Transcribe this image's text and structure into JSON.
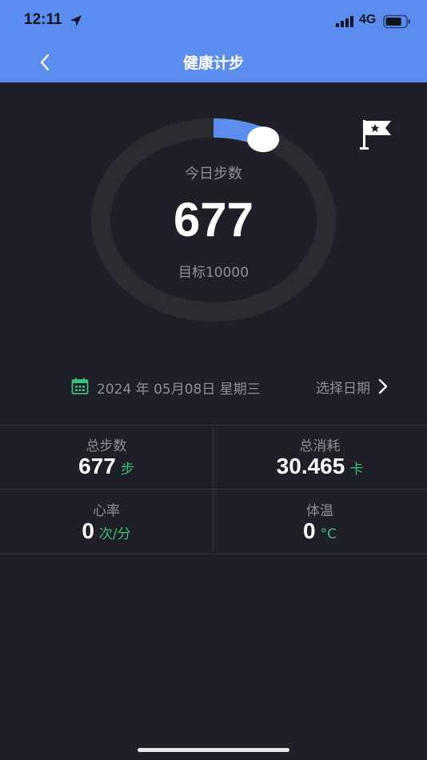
{
  "status_bar": {
    "time": "12:11",
    "network": "4G",
    "battery_level": 0.8,
    "icons": [
      "location-arrow-icon",
      "signal-icon",
      "battery-icon"
    ]
  },
  "nav": {
    "title": "健康计步",
    "back_icon": "chevron-left-icon"
  },
  "ring": {
    "label": "今日步数",
    "steps": 677,
    "steps_text": "677",
    "goal": 10000,
    "goal_text": "目标10000",
    "flag_icon": "flag-star-icon"
  },
  "date_row": {
    "date_text": "2024 年 05月08日  星期三",
    "select_label": "选择日期",
    "calendar_icon": "calendar-icon"
  },
  "stats": [
    {
      "label": "总步数",
      "value": "677",
      "unit": "步"
    },
    {
      "label": "总消耗",
      "value": "30.465",
      "unit": "卡"
    },
    {
      "label": "心率",
      "value": "0",
      "unit": "次/分"
    },
    {
      "label": "体温",
      "value": "0",
      "unit": "°C"
    }
  ],
  "colors": {
    "header": "#5b8def",
    "background": "#1e1f27",
    "ring_track": "#2b2c32",
    "ring_progress": "#5b8def",
    "accent_green": "#3fbf7f",
    "muted_text": "#8e9097"
  }
}
